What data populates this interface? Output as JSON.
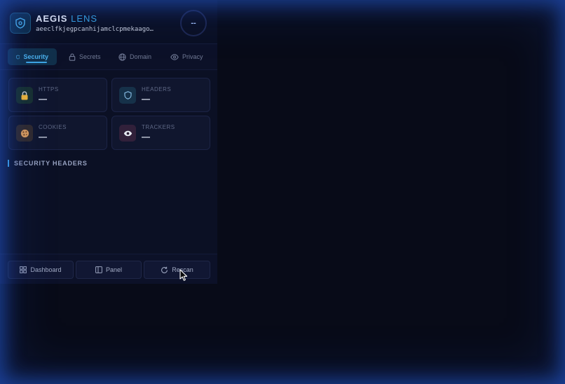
{
  "header": {
    "brand_primary": "AEGIS",
    "brand_accent": "LENS",
    "url": "aeeclfkjegpcanhijamclcpmekaago…",
    "score": "--",
    "logo_icon": "shield-icon"
  },
  "tabs": [
    {
      "label": "Security",
      "icon": "shield-icon",
      "active": true
    },
    {
      "label": "Secrets",
      "icon": "lock-icon",
      "active": false
    },
    {
      "label": "Domain",
      "icon": "globe-icon",
      "active": false
    },
    {
      "label": "Privacy",
      "icon": "eye-icon",
      "active": false
    }
  ],
  "cards": [
    {
      "label": "HTTPS",
      "value": "—",
      "icon": "lock-icon"
    },
    {
      "label": "HEADERS",
      "value": "—",
      "icon": "shield-icon"
    },
    {
      "label": "COOKIES",
      "value": "—",
      "icon": "cookie-icon"
    },
    {
      "label": "TRACKERS",
      "value": "—",
      "icon": "eye-icon"
    }
  ],
  "section_title": "SECURITY HEADERS",
  "footer": {
    "dashboard_label": "Dashboard",
    "panel_label": "Panel",
    "rescan_label": "Rescan"
  },
  "colors": {
    "accent": "#3ea6e6",
    "background": "#080b18",
    "glow": "#2864e6"
  }
}
